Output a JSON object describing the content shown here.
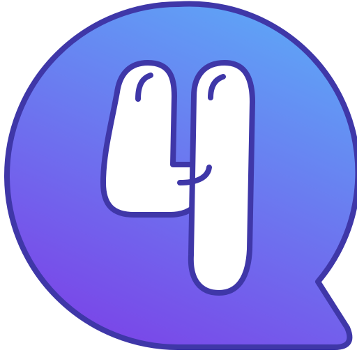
{
  "icon": {
    "name": "number-four-speech-bubble-icon",
    "glyph": "4"
  },
  "colors": {
    "outline": "#3f37a8",
    "gradient_top": "#5fa3f6",
    "gradient_bottom": "#7a46e8",
    "glyph_fill": "#ffffff"
  }
}
